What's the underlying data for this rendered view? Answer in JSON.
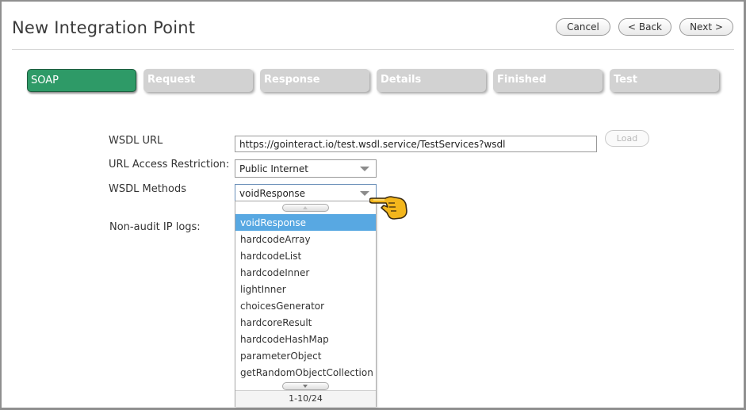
{
  "page": {
    "title": "New Integration Point"
  },
  "header_buttons": {
    "cancel": "Cancel",
    "back": "< Back",
    "next": "Next >"
  },
  "steps": [
    {
      "label": "SOAP",
      "active": true
    },
    {
      "label": "Request",
      "active": false
    },
    {
      "label": "Response",
      "active": false
    },
    {
      "label": "Details",
      "active": false
    },
    {
      "label": "Finished",
      "active": false
    },
    {
      "label": "Test",
      "active": false
    }
  ],
  "form": {
    "wsdl_url_label": "WSDL URL",
    "wsdl_url_value": "https://gointeract.io/test.wsdl.service/TestServices?wsdl",
    "load_label": "Load",
    "access_label": "URL Access Restriction:",
    "access_value": "Public Internet",
    "methods_label": "WSDL Methods",
    "methods_value": "voidResponse",
    "nonaudit_label": "Non-audit IP logs:"
  },
  "dropdown": {
    "options": [
      "voidResponse",
      "hardcodeArray",
      "hardcodeList",
      "hardcodeInner",
      "lightInner",
      "choicesGenerator",
      "hardcoreResult",
      "hardcodeHashMap",
      "parameterObject",
      "getRandomObjectCollection"
    ],
    "selected_index": 0,
    "pager": "1-10/24"
  },
  "colors": {
    "active_step": "#2e9a67",
    "inactive_step": "#d2d2d2",
    "selected_option": "#58a8e2"
  }
}
